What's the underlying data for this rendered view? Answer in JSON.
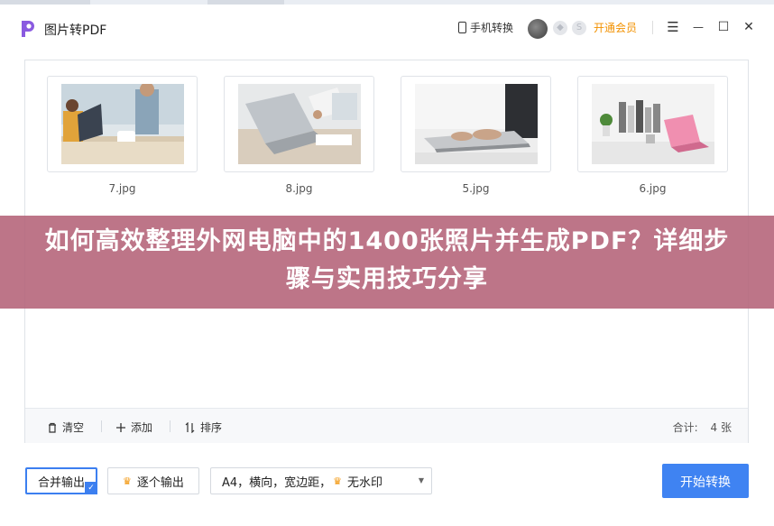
{
  "app": {
    "title": "图片转PDF"
  },
  "toolbar": {
    "phone_convert": "手机转换",
    "vip_label": "开通会员",
    "badge1": "◆",
    "badge2": "S"
  },
  "window": {
    "menu": "☰",
    "minimize": "—",
    "maximize": "☐",
    "close": "✕"
  },
  "images": [
    {
      "name": "7.jpg"
    },
    {
      "name": "8.jpg"
    },
    {
      "name": "5.jpg"
    },
    {
      "name": "6.jpg"
    }
  ],
  "overlay": {
    "title": "如何高效整理外网电脑中的1400张照片并生成PDF？详细步骤与实用技巧分享"
  },
  "panel_footer": {
    "clear": "清空",
    "add": "添加",
    "sort": "排序",
    "count_label": "合计:",
    "count_value": "4 张"
  },
  "output": {
    "merge": "合并输出",
    "each": "逐个输出",
    "settings": "A4，横向，宽边距，",
    "watermark": "无水印",
    "start": "开始转换"
  },
  "colors": {
    "accent": "#3f83f2",
    "vip": "#f29100",
    "overlay": "#b46278"
  }
}
